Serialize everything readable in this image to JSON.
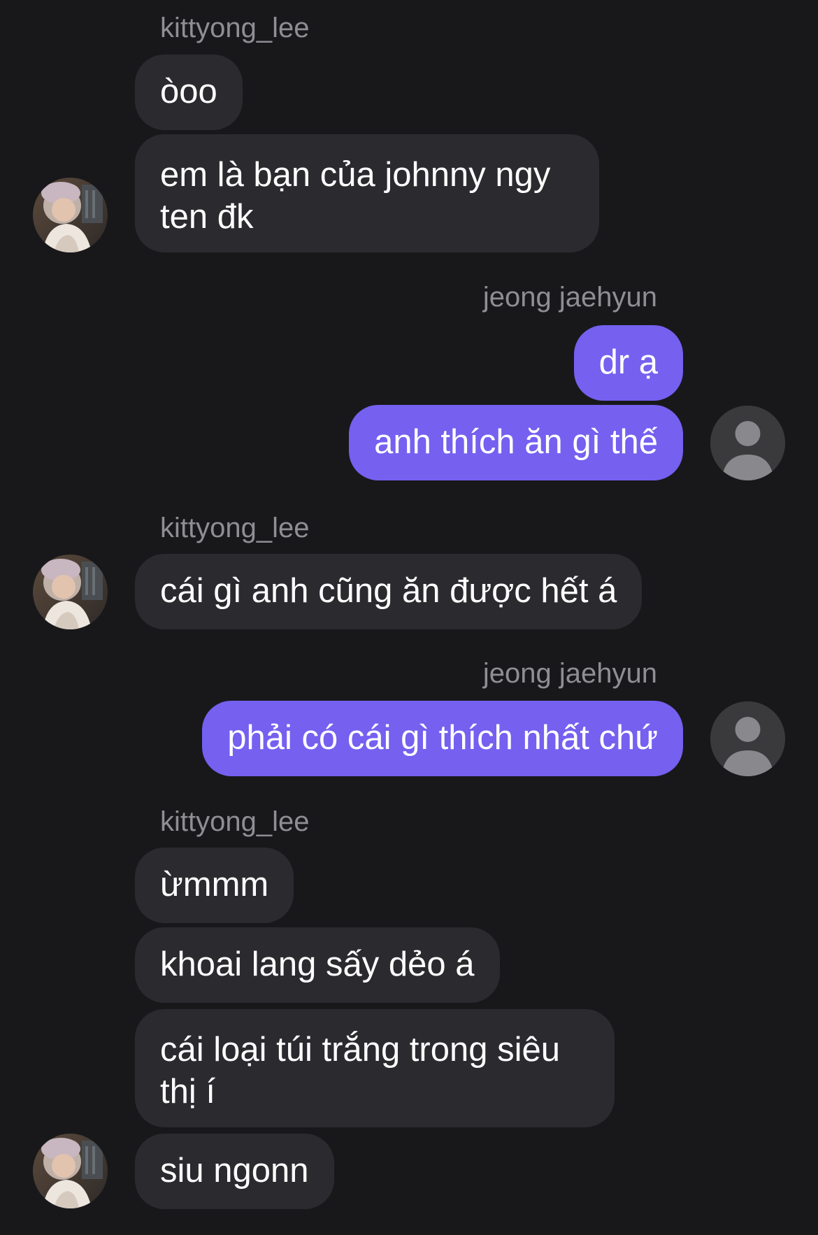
{
  "messages": [
    {
      "sender": "kittyong_lee",
      "text": "òoo"
    },
    {
      "sender": "kittyong_lee",
      "text": "em là bạn của johnny ngy ten đk"
    },
    {
      "sender": "jeong jaehyun",
      "text": "dr ạ"
    },
    {
      "sender": "jeong jaehyun",
      "text": "anh thích ăn gì thế"
    },
    {
      "sender": "kittyong_lee",
      "text": "cái gì anh cũng ăn được hết á"
    },
    {
      "sender": "jeong jaehyun",
      "text": "phải có cái gì thích nhất chứ"
    },
    {
      "sender": "kittyong_lee",
      "text": "ừmmm"
    },
    {
      "sender": "kittyong_lee",
      "text": "khoai lang sấy dẻo á"
    },
    {
      "sender": "kittyong_lee",
      "text": "cái loại túi trắng trong siêu thị í"
    },
    {
      "sender": "kittyong_lee",
      "text": "siu ngonn"
    }
  ],
  "groups": [
    {
      "name": "kittyong_lee",
      "side": "left"
    },
    {
      "name": "jeong jaehyun",
      "side": "right"
    },
    {
      "name": "kittyong_lee",
      "side": "left"
    },
    {
      "name": "jeong jaehyun",
      "side": "right"
    },
    {
      "name": "kittyong_lee",
      "side": "left"
    }
  ],
  "colors": {
    "background": "#18181b",
    "incoming_bubble": "#2b2b2f",
    "outgoing_bubble": "#7560f0",
    "name_text": "#8e8e93",
    "message_text": "#ffffff"
  },
  "icons": {
    "incoming_avatar": "user-photo-avatar",
    "outgoing_avatar": "default-person-avatar-icon"
  }
}
